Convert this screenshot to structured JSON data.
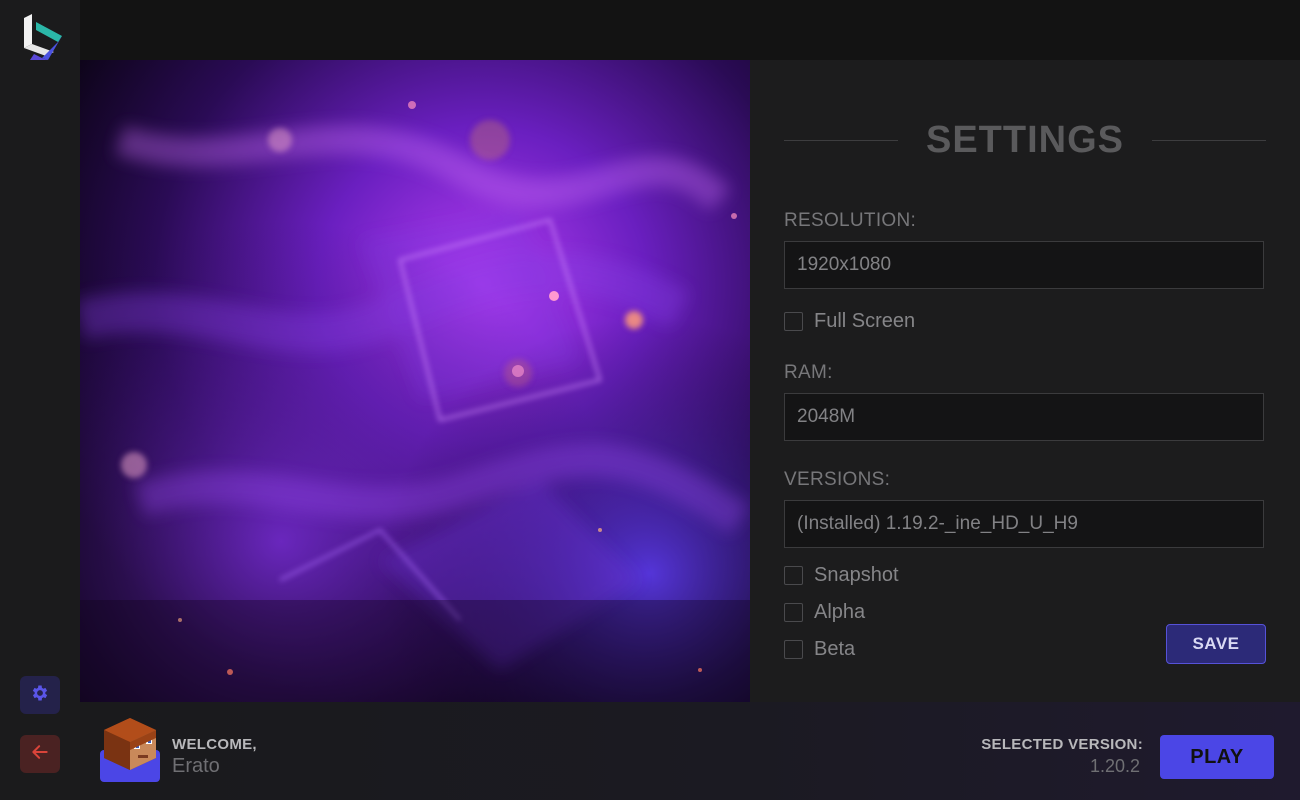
{
  "app": {
    "logo_icon": "launcher-logo-icon",
    "accent": "#4b46e6",
    "danger": "#d9443a"
  },
  "sidebar": {
    "settings_icon": "gear-icon",
    "logout_icon": "arrow-left-icon"
  },
  "settings": {
    "title": "SETTINGS",
    "resolution_label": "RESOLUTION:",
    "resolution_value": "1920x1080",
    "fullscreen_label": "Full Screen",
    "ram_label": "RAM:",
    "ram_value": "2048M",
    "versions_label": "VERSIONS:",
    "versions_value": "(Installed) 1.19.2-_ine_HD_U_H9",
    "snapshot_label": "Snapshot",
    "alpha_label": "Alpha",
    "beta_label": "Beta",
    "save_label": "SAVE"
  },
  "footer": {
    "welcome_label": "WELCOME,",
    "username": "Erato",
    "selected_version_label": "SELECTED VERSION:",
    "selected_version_value": "1.20.2",
    "play_label": "PLAY"
  }
}
